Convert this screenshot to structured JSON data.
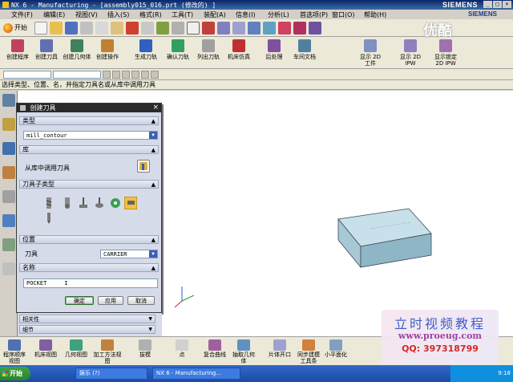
{
  "window": {
    "title": "NX 6 - Manufacturing - [assembly015_016.prt (修改的) ]",
    "brand": "SIEMENS",
    "controls": [
      "_",
      "□",
      "×"
    ]
  },
  "menubar": {
    "items": [
      "文件(F)",
      "编辑(E)",
      "视图(V)",
      "插入(S)",
      "格式(R)",
      "工具(T)",
      "装配(A)",
      "信息(I)",
      "分析(L)",
      "首选项(P)",
      "窗口(O)",
      "帮助(H)"
    ],
    "brand": "SIEMENS"
  },
  "toolbar1": {
    "start_label": "开始"
  },
  "toolbar2": {
    "buttons": [
      "创建程序",
      "创建刀具",
      "创建几何体",
      "创建操作",
      "生成刀轨",
      "确认刀轨",
      "列出刀轨",
      "机床仿真",
      "后处理",
      "车间文档",
      "显示 2D 工件",
      "显示 2D IPW",
      "显示锁定 2D IPW"
    ]
  },
  "cue_line": "选择类型、位置、名，并指定刀具名或从库中调用刀具",
  "dialog": {
    "title": "创建刀具",
    "close_label": "×",
    "type_header": "类型",
    "type_value": "mill_contour",
    "library_header": "库",
    "library_label": "从库中调用刀具",
    "subtype_header": "刀具子类型",
    "location_header": "位置",
    "tool_label": "刀具",
    "tool_value": "CARRIER",
    "name_header": "名称",
    "name_value": "POCKET",
    "ok_label": "确定",
    "apply_label": "应用",
    "cancel_label": "取消"
  },
  "navpanel": {
    "rows": [
      "相关性",
      "细节"
    ]
  },
  "bottombar": {
    "buttons": [
      "程序顺序视图",
      "机床视图",
      "几何视图",
      "加工方法视图",
      "拔模",
      "点",
      "复合曲线",
      "抽取几何体",
      "片体开口",
      "同步建模工具条",
      "小平面化"
    ]
  },
  "taskbar": {
    "start_label": "开始",
    "tasks": [
      "娱乐 (?)",
      "NX 6 - Manufacturing..."
    ],
    "clock": "9:18"
  },
  "watermark": {
    "title": "立时视频教程",
    "url": "www.proeug.com",
    "qq": "QQ: 397318799",
    "corner": "优酷"
  },
  "colors": {
    "title_bar": "#0a246a",
    "dialog_bg": "#d6dbe9",
    "part_top": "#c8e0ea",
    "part_side": "#8fb6c6",
    "taskbar": "#245edb"
  }
}
